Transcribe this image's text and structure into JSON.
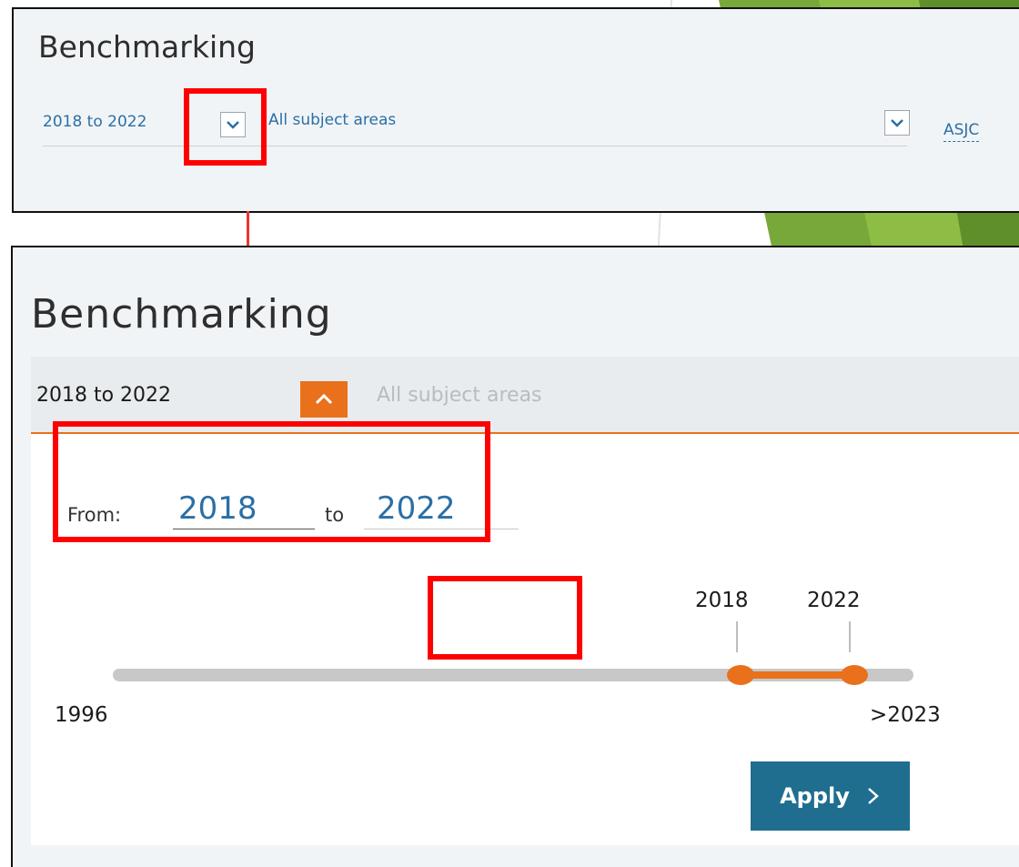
{
  "top_panel": {
    "title": "Benchmarking",
    "period": "2018 to 2022",
    "subject": "All subject areas",
    "classification": "ASJC"
  },
  "bottom_panel": {
    "title": "Benchmarking",
    "period": "2018 to 2022",
    "subject": "All subject areas",
    "from_label": "From:",
    "from_value": "2018",
    "to_label": "to",
    "to_value": "2022",
    "slider": {
      "min_label": "1996",
      "max_label": ">2023",
      "selected_start": "2018",
      "selected_end": "2022"
    },
    "apply_label": "Apply"
  },
  "colors": {
    "accent_orange": "#e9711c",
    "apply_blue": "#1f6e90",
    "link_blue": "#2b6fa5",
    "highlight_red": "#ff0000"
  },
  "icons": {
    "period_toggle_collapsed": "chevron-down-icon",
    "subject_toggle": "chevron-down-icon",
    "period_toggle_expanded": "chevron-up-icon",
    "apply": "chevron-right-icon"
  }
}
